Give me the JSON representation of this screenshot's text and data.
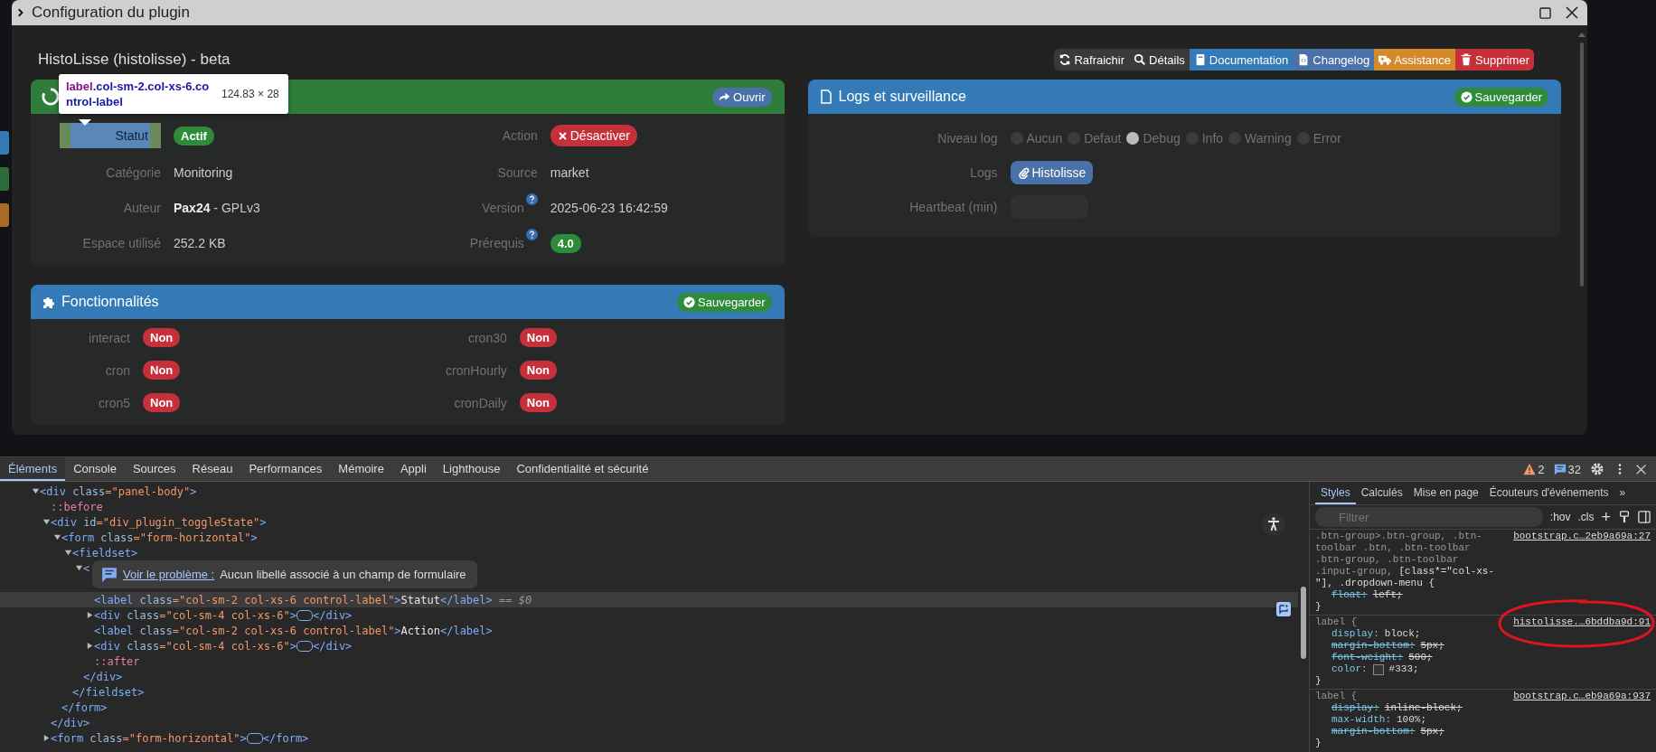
{
  "modal": {
    "title": "Configuration du plugin",
    "heading": "HistoLisse (histolisse) - beta",
    "actions": [
      {
        "label": "Rafraichir",
        "color": "#3a3a3a"
      },
      {
        "label": "Détails",
        "color": "#3a3a3a"
      },
      {
        "label": "Documentation",
        "color": "#337ab7"
      },
      {
        "label": "Changelog",
        "color": "#4a72a8"
      },
      {
        "label": "Assistance",
        "color": "#d48a2c"
      },
      {
        "label": "Supprimer",
        "color": "#c6303a"
      }
    ],
    "state_panel": {
      "button": "Ouvrir",
      "fields": [
        {
          "label": "Statut",
          "highlighted": true,
          "kind": "badge",
          "value": "Actif",
          "color": "#2e8b3a"
        },
        {
          "label": "Action",
          "highlighted": false,
          "kind": "button",
          "value": "Désactiver",
          "color": "#c6303a"
        },
        {
          "label": "Catégorie",
          "highlighted": false,
          "kind": "text",
          "value": "Monitoring"
        },
        {
          "label": "Source",
          "highlighted": false,
          "kind": "text",
          "value": "market"
        },
        {
          "label": "Auteur",
          "highlighted": false,
          "kind": "text",
          "value": "**Pax24** - GPLv3"
        },
        {
          "label": "Version",
          "highlighted": false,
          "help": true,
          "kind": "text",
          "value": "2025-06-23 16:42:59"
        },
        {
          "label": "Espace utilisé",
          "highlighted": false,
          "kind": "text",
          "value": "252.2 KB"
        },
        {
          "label": "Prérequis",
          "highlighted": false,
          "help": true,
          "kind": "badge",
          "value": "4.0",
          "color": "#2e8b3a"
        }
      ]
    },
    "inspector_tooltip": {
      "selector": "label",
      "classes": ".col-sm-2.col-xs-6.control-label",
      "size": "124.83 × 28"
    },
    "features_panel": {
      "title": "Fonctionnalités",
      "button": "Sauvegarder",
      "items": [
        {
          "label": "interact",
          "value": "Non"
        },
        {
          "label": "cron30",
          "value": "Non"
        },
        {
          "label": "cron",
          "value": "Non"
        },
        {
          "label": "cronHourly",
          "value": "Non"
        },
        {
          "label": "cron5",
          "value": "Non"
        },
        {
          "label": "cronDaily",
          "value": "Non"
        }
      ]
    },
    "logs_panel": {
      "title": "Logs et surveillance",
      "button": "Sauvegarder",
      "level_label": "Niveau log",
      "levels": [
        {
          "label": "Aucun",
          "selected": false
        },
        {
          "label": "Defaut",
          "selected": false
        },
        {
          "label": "Debug",
          "selected": true
        },
        {
          "label": "Info",
          "selected": false
        },
        {
          "label": "Warning",
          "selected": false
        },
        {
          "label": "Error",
          "selected": false
        }
      ],
      "logs_label": "Logs",
      "log_button": "Histolisse",
      "heartbeat_label": "Heartbeat (min)"
    }
  },
  "devtools": {
    "tabs": [
      {
        "label": "Éléments",
        "selected": true
      },
      {
        "label": "Console",
        "selected": false
      },
      {
        "label": "Sources",
        "selected": false
      },
      {
        "label": "Réseau",
        "selected": false
      },
      {
        "label": "Performances",
        "selected": false
      },
      {
        "label": "Mémoire",
        "selected": false
      },
      {
        "label": "Appli",
        "selected": false
      },
      {
        "label": "Lighthouse",
        "selected": false
      },
      {
        "label": "Confidentialité et sécurité",
        "selected": false
      }
    ],
    "warnings": "2",
    "messages": "32",
    "tree": [
      {
        "kind": "element",
        "open": "<div",
        "attr": "class=\"panel-body\"",
        "end": ">",
        "expanded": true,
        "children": [
          {
            "kind": "pseudo",
            "text": "::before"
          },
          {
            "kind": "element",
            "open": "<div",
            "attr": "id=\"div_plugin_toggleState\"",
            "end": ">",
            "expanded": true,
            "close": "</div>",
            "children": [
              {
                "kind": "element",
                "open": "<form",
                "attr": "class=\"form-horizontal\"",
                "end": ">",
                "expanded": true,
                "close": "</form>",
                "children": [
                  {
                    "kind": "element",
                    "open": "<fieldset",
                    "end": ">",
                    "expanded": true,
                    "close": "</fieldset>",
                    "children": [
                      {
                        "kind": "element",
                        "open": "<",
                        "expanded": true,
                        "close": "</div>",
                        "issue": {
                          "link": "Voir le problème :",
                          "text": "Aucun libellé associé à un champ de formulaire"
                        },
                        "children": [
                          {
                            "kind": "element",
                            "open": "<label",
                            "attr": "class=\"col-sm-2 col-xs-6 control-label\"",
                            "end": ">",
                            "content": "Statut",
                            "close": "</label>",
                            "selected": true,
                            "suffix": "== $0"
                          },
                          {
                            "kind": "element",
                            "open": "<div",
                            "attr": "class=\"col-sm-4 col-xs-6\"",
                            "end": ">",
                            "expanded": false,
                            "close": "</div>"
                          },
                          {
                            "kind": "element",
                            "open": "<label",
                            "attr": "class=\"col-sm-2 col-xs-6 control-label\"",
                            "end": ">",
                            "content": "Action",
                            "close": "</label>",
                            "selected": false
                          },
                          {
                            "kind": "element",
                            "open": "<div",
                            "attr": "class=\"col-sm-4 col-xs-6\"",
                            "end": ">",
                            "expanded": false,
                            "close": "</div>"
                          },
                          {
                            "kind": "pseudo",
                            "text": "::after"
                          }
                        ]
                      }
                    ]
                  }
                ]
              }
            ]
          },
          {
            "kind": "element",
            "open": "<form",
            "attr": "class=\"form-horizontal\"",
            "end": ">",
            "expanded": false,
            "close": "</form>"
          }
        ]
      }
    ],
    "styles_tabs": [
      {
        "label": "Styles",
        "selected": true
      },
      {
        "label": "Calculés",
        "selected": false
      },
      {
        "label": "Mise en page",
        "selected": false
      },
      {
        "label": "Écouteurs d'événements",
        "selected": false
      }
    ],
    "more_tabs": "»",
    "filter_placeholder": "Filtrer",
    "hov": ":hov",
    "cls": ".cls",
    "plus": "+",
    "rules": [
      {
        "selector": ".btn-group>.btn-group, .btn-toolbar .btn, .btn-toolbar .btn-group, .btn-toolbar .input-group,",
        "matched": "[class*=\"col-xs-\"]",
        "rest": ", .dropdown-menu {",
        "source": "bootstrap.c…2eb9a69a:27",
        "decls": [
          {
            "prop": "float:",
            "value": "left;",
            "struck": true
          }
        ],
        "close": "}"
      },
      {
        "selector": "label {",
        "source": "histolisse.…6bddba9d:91",
        "annotated": true,
        "decls": [
          {
            "prop": "display:",
            "value": "block;",
            "struck": false
          },
          {
            "prop": "margin-bottom:",
            "value": "5px;",
            "struck": true
          },
          {
            "prop": "font-weight:",
            "value": "500;",
            "struck": true
          },
          {
            "prop": "color:",
            "value": "#333;",
            "struck": false,
            "swatch": true
          }
        ],
        "close": "}"
      },
      {
        "selector": "label {",
        "source": "bootstrap.c…eb9a69a:937",
        "decls": [
          {
            "prop": "display:",
            "value": "inline-block;",
            "struck": true
          },
          {
            "prop": "max-width:",
            "value": "100%;",
            "struck": false
          },
          {
            "prop": "margin-bottom:",
            "value": "5px;",
            "struck": true
          }
        ],
        "close": "}"
      }
    ]
  }
}
